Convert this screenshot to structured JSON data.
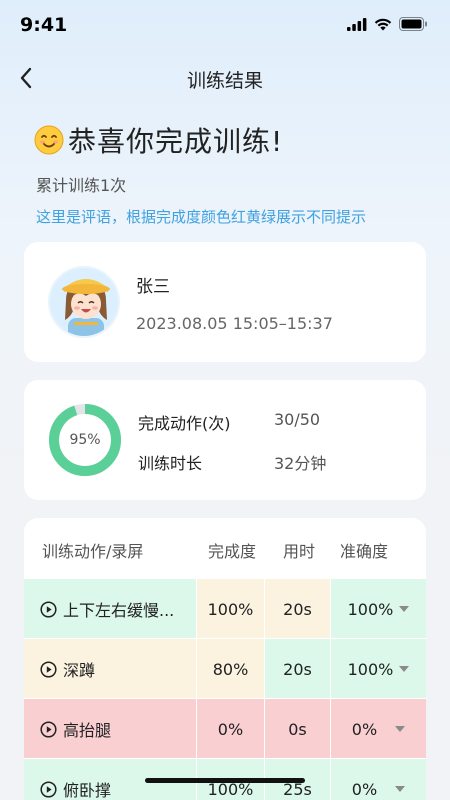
{
  "status_bar": {
    "time": "9:41"
  },
  "nav": {
    "title": "训练结果"
  },
  "result": {
    "congrats": "恭喜你完成训练!",
    "train_count": "累计训练1次",
    "comment": "这里是评语，根据完成度颜色红黄绿展示不同提示"
  },
  "user": {
    "name": "张三",
    "time_range": "2023.08.05 15:05–15:37"
  },
  "stats": {
    "progress_percent_label": "95%",
    "progress": 0.95,
    "actions_label": "完成动作(次)",
    "actions_value": "30/50",
    "duration_label": "训练时长",
    "duration_value": "32分钟"
  },
  "table": {
    "headers": {
      "action": "训练动作/录屏",
      "completion": "完成度",
      "time": "用时",
      "accuracy": "准确度"
    },
    "rows": [
      {
        "name": "上下左右缓慢...",
        "completion": "100%",
        "time": "20s",
        "accuracy": "100%"
      },
      {
        "name": "深蹲",
        "completion": "80%",
        "time": "20s",
        "accuracy": "100%"
      },
      {
        "name": "高抬腿",
        "completion": "0%",
        "time": "0s",
        "accuracy": "0%"
      },
      {
        "name": "俯卧撑",
        "completion": "100%",
        "time": "25s",
        "accuracy": "0%"
      }
    ]
  },
  "colors": {
    "green_cell": "#dbf8ea",
    "yellow_cell": "#fbf3e0",
    "red_cell": "#f9cfd1",
    "ring_progress": "#5bcf98",
    "ring_track": "#e2e5e8",
    "comment_blue": "#3fa1e0"
  }
}
